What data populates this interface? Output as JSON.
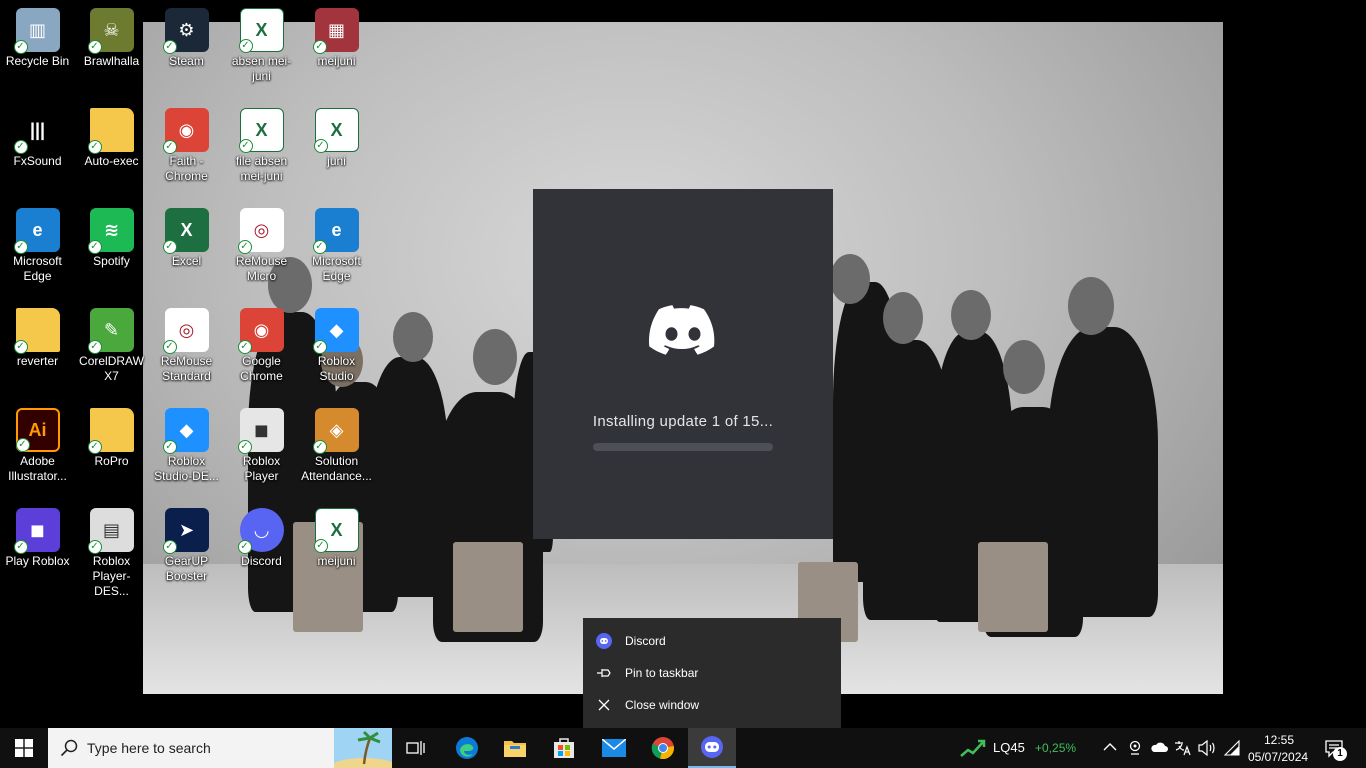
{
  "desktop_icons": [
    {
      "label": "Recycle Bin",
      "icon": "recycle-bin-icon"
    },
    {
      "label": "Brawlhalla",
      "icon": "brawlhalla-icon"
    },
    {
      "label": "Steam",
      "icon": "steam-icon"
    },
    {
      "label": "absen mei-juni",
      "icon": "excel-file-icon"
    },
    {
      "label": "meijuni",
      "icon": "winrar-archive-icon"
    },
    {
      "label": "FxSound",
      "icon": "fxsound-icon"
    },
    {
      "label": "Auto-exec",
      "icon": "folder-icon"
    },
    {
      "label": "Faith - Chrome",
      "icon": "chrome-profile-icon"
    },
    {
      "label": "file absen mei-juni",
      "icon": "excel-file-icon"
    },
    {
      "label": "juni",
      "icon": "excel-file-icon"
    },
    {
      "label": "Microsoft Edge",
      "icon": "edge-icon"
    },
    {
      "label": "Spotify",
      "icon": "spotify-icon"
    },
    {
      "label": "Excel",
      "icon": "excel-app-icon"
    },
    {
      "label": "ReMouse Micro",
      "icon": "remouse-icon"
    },
    {
      "label": "Microsoft Edge",
      "icon": "edge-icon"
    },
    {
      "label": "reverter",
      "icon": "folder-icon"
    },
    {
      "label": "CorelDRAW X7",
      "icon": "coreldraw-icon"
    },
    {
      "label": "ReMouse Standard",
      "icon": "remouse-icon"
    },
    {
      "label": "Google Chrome",
      "icon": "chrome-icon"
    },
    {
      "label": "Roblox Studio",
      "icon": "roblox-studio-icon"
    },
    {
      "label": "Adobe Illustrator...",
      "icon": "illustrator-icon"
    },
    {
      "label": "RoPro",
      "icon": "folder-icon"
    },
    {
      "label": "Roblox Studio-DE...",
      "icon": "roblox-studio-icon"
    },
    {
      "label": "Roblox Player",
      "icon": "roblox-player-icon"
    },
    {
      "label": "Solution Attendance...",
      "icon": "solution-attendance-icon"
    },
    {
      "label": "Play Roblox",
      "icon": "play-roblox-icon"
    },
    {
      "label": "Roblox Player-DES...",
      "icon": "roblox-player-file-icon"
    },
    {
      "label": "GearUP Booster",
      "icon": "gearup-booster-icon"
    },
    {
      "label": "Discord",
      "icon": "discord-icon"
    },
    {
      "label": "meijuni",
      "icon": "excel-file-icon"
    }
  ],
  "splash": {
    "status": "Installing update 1 of 15...",
    "progress": 0.0
  },
  "jumplist": {
    "app_label": "Discord",
    "pin_label": "Pin to taskbar",
    "close_label": "Close window"
  },
  "taskbar": {
    "search_placeholder": "Type here to search",
    "apps": [
      "task-view-icon",
      "edge-icon",
      "file-explorer-icon",
      "microsoft-store-icon",
      "mail-icon",
      "chrome-icon",
      "discord-icon"
    ],
    "stock": {
      "ticker": "LQ45",
      "change": "+0,25%"
    },
    "time": "12:55",
    "date": "05/07/2024",
    "notification_count": "1"
  },
  "colors": {
    "discord_blurple": "#5865f2",
    "splash_bg": "#313338",
    "stock_up": "#3fbf5a",
    "taskbar_bg": "#101010"
  }
}
